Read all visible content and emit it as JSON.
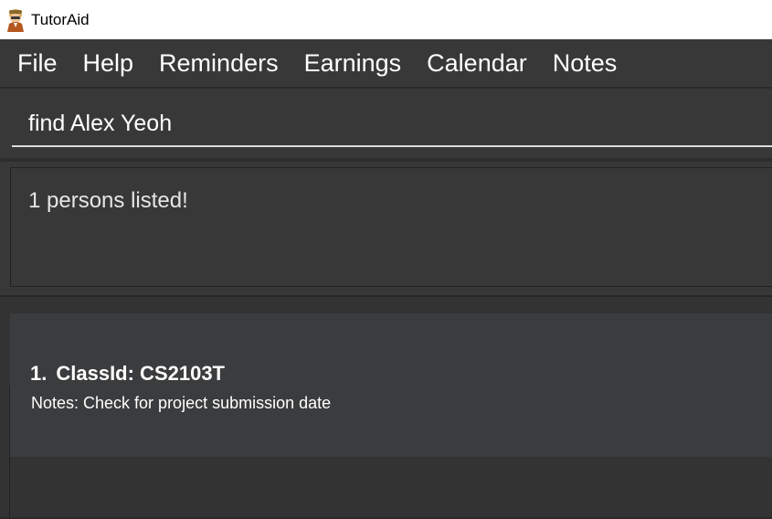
{
  "window": {
    "title": "TutorAid",
    "icon": "app-avatar-icon"
  },
  "menu": {
    "items": [
      {
        "label": "File"
      },
      {
        "label": "Help"
      },
      {
        "label": "Reminders"
      },
      {
        "label": "Earnings"
      },
      {
        "label": "Calendar"
      },
      {
        "label": "Notes"
      }
    ]
  },
  "command": {
    "value": "find Alex Yeoh",
    "placeholder": ""
  },
  "result": {
    "message": "1 persons listed!"
  },
  "list": {
    "items": [
      {
        "index": "1.",
        "title": "ClassId: CS2103T",
        "notes": "Notes: Check for project submission date"
      }
    ]
  },
  "colors": {
    "menubar": "#383838",
    "background": "#2b2b2b",
    "card": "#3b3c3d",
    "text": "#ffffff"
  }
}
